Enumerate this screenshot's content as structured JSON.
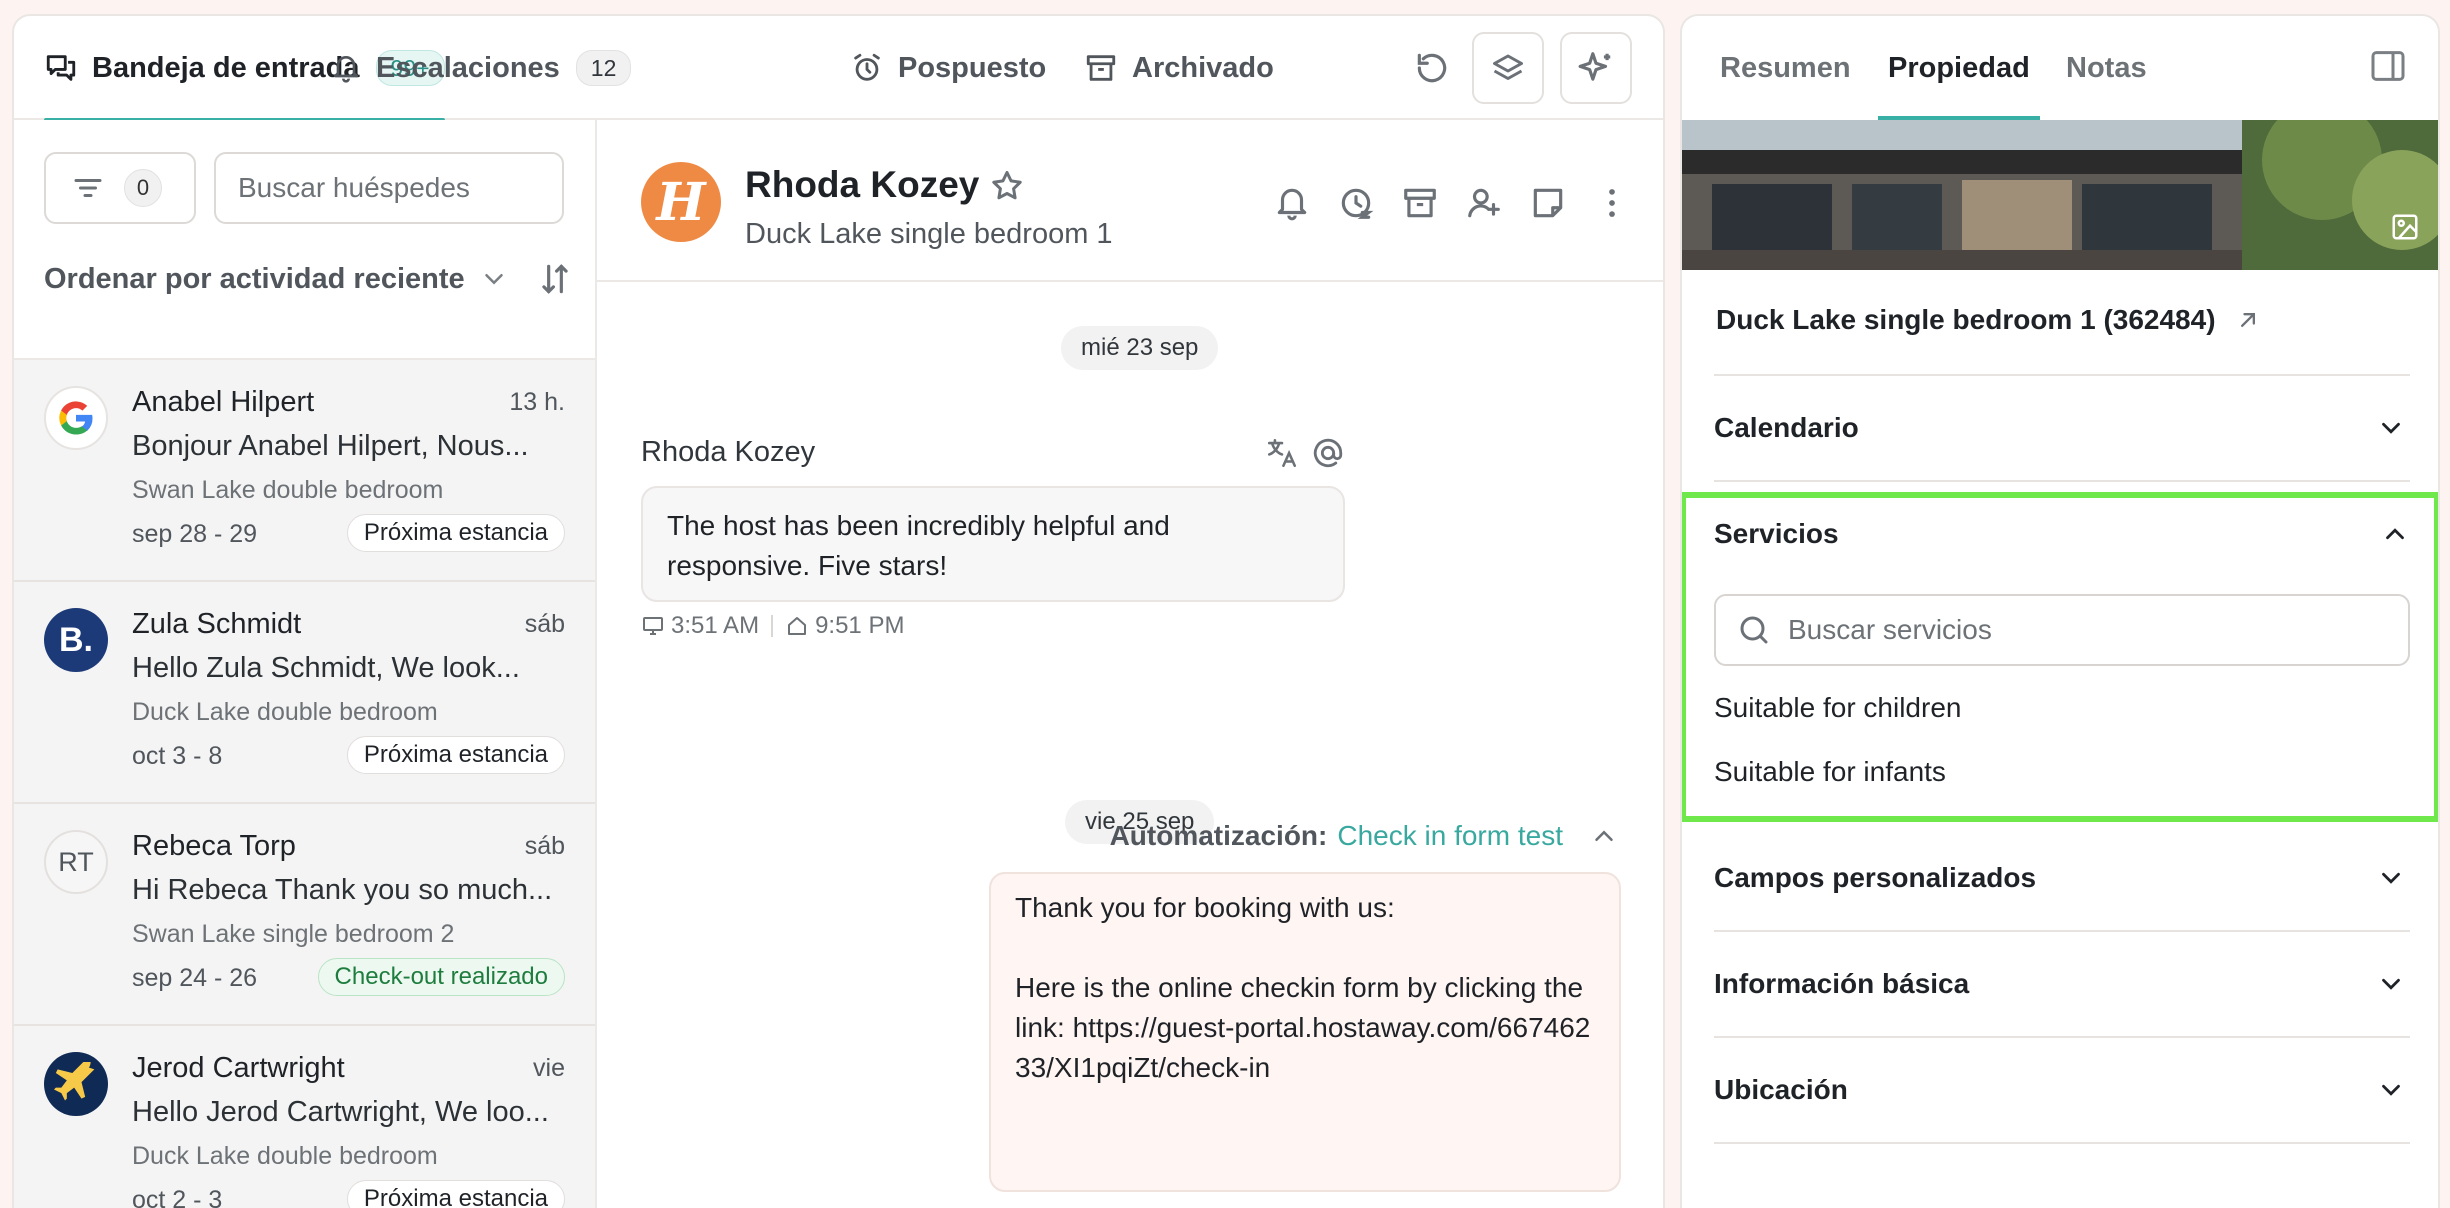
{
  "nav": {
    "tabs": [
      {
        "label": "Bandeja de entrada",
        "badge": "99+"
      },
      {
        "label": "Escalaciones",
        "badge": "12"
      },
      {
        "label": "Pospuesto"
      },
      {
        "label": "Archivado"
      }
    ]
  },
  "list": {
    "filter_count": "0",
    "search_placeholder": "Buscar huéspedes",
    "sort_label": "Ordenar por actividad reciente",
    "conversations": [
      {
        "name": "Anabel Hilpert",
        "time": "13 h.",
        "preview": "Bonjour Anabel Hilpert, Nous...",
        "listing": "Swan Lake double bedroom",
        "dates": "sep 28 - 29",
        "status": "Próxima estancia",
        "avatar": "google-icon"
      },
      {
        "name": "Zula Schmidt",
        "time": "sáb",
        "preview": "Hello Zula Schmidt, We look...",
        "listing": "Duck Lake double bedroom",
        "dates": "oct 3 - 8",
        "status": "Próxima estancia",
        "avatar": "booking-icon",
        "avatar_text": "B."
      },
      {
        "name": "Rebeca Torp",
        "time": "sáb",
        "preview": "Hi Rebeca Thank you so much...",
        "listing": "Swan Lake single bedroom 2",
        "dates": "sep 24 - 26",
        "status": "Check-out realizado",
        "avatar": "initials-avatar",
        "avatar_text": "RT"
      },
      {
        "name": "Jerod Cartwright",
        "time": "vie",
        "preview": "Hello Jerod Cartwright, We loo...",
        "listing": "Duck Lake double bedroom",
        "dates": "oct 2 - 3",
        "status": "Próxima estancia",
        "avatar": "expedia-icon"
      }
    ]
  },
  "chat": {
    "guest_name": "Rhoda Kozey",
    "avatar_letter": "H",
    "listing": "Duck Lake single bedroom 1",
    "date1": "mié 23 sep",
    "sender": "Rhoda Kozey",
    "message_in": "The host has been incredibly helpful and responsive. Five stars!",
    "time_guest": "3:51 AM",
    "time_host": "9:51 PM",
    "date2": "vie 25 sep",
    "automation_label": "Automatización:",
    "automation_name": "Check in form test",
    "message_out": "Thank you for booking with us:\n\nHere is the online checkin form by clicking the link: https://guest-portal.hostaway.com/66746233/XI1pqiZt/check-in"
  },
  "side": {
    "tabs": [
      "Resumen",
      "Propiedad",
      "Notas"
    ],
    "property_title": "Duck Lake single bedroom 1 (362484)",
    "sections": {
      "calendar": "Calendario",
      "services": "Servicios",
      "custom_fields": "Campos personalizados",
      "basic_info": "Información básica",
      "location": "Ubicación"
    },
    "services_search_placeholder": "Buscar servicios",
    "services_items": [
      "Suitable for children",
      "Suitable for infants"
    ]
  },
  "colors": {
    "accent": "#39b0a6",
    "highlight": "#6fe84c",
    "avatar_orange": "#ef8a45"
  }
}
